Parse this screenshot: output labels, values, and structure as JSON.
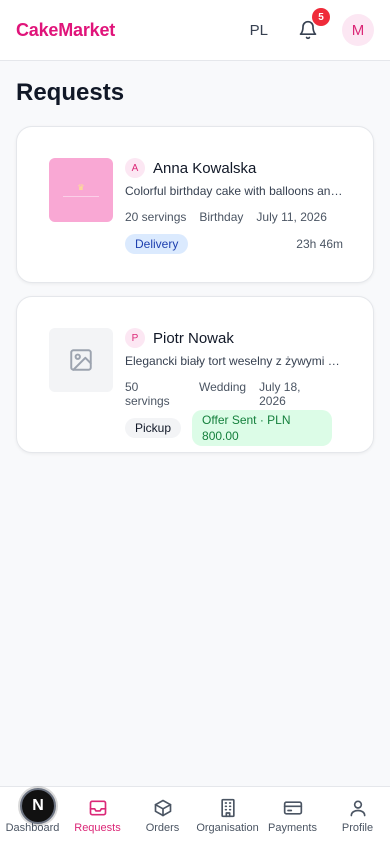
{
  "header": {
    "logo": "CakeMarket",
    "lang": "PL",
    "notifications_count": "5",
    "user_initial": "M"
  },
  "page": {
    "title": "Requests"
  },
  "requests": [
    {
      "initial": "A",
      "customer": "Anna Kowalska",
      "description": "Colorful birthday cake with balloons and stars",
      "servings": "20 servings",
      "occasion": "Birthday",
      "date": "July 11, 2026",
      "fulfillment": "Delivery",
      "time_left": "23h 46m"
    },
    {
      "initial": "P",
      "customer": "Piotr Nowak",
      "description": "Elegancki biały tort weselny z żywymi kwiatami",
      "servings": "50 servings",
      "occasion": "Wedding",
      "date": "July 18, 2026",
      "fulfillment": "Pickup",
      "status": "Offer Sent · PLN 800.00"
    }
  ],
  "nav": {
    "dev_badge": "N",
    "items": [
      {
        "label": "Dashboard",
        "icon": "dashboard-icon"
      },
      {
        "label": "Requests",
        "icon": "inbox-icon",
        "active": true
      },
      {
        "label": "Orders",
        "icon": "box-icon"
      },
      {
        "label": "Organisation",
        "icon": "building-icon"
      },
      {
        "label": "Payments",
        "icon": "card-icon"
      },
      {
        "label": "Profile",
        "icon": "user-icon"
      }
    ]
  },
  "colors": {
    "brand": "#e0147a",
    "accent_pink": "#db2777",
    "badge_red": "#ef2b3a"
  }
}
